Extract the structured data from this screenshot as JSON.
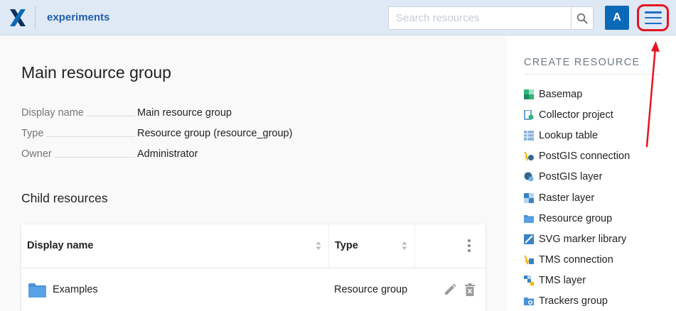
{
  "header": {
    "title": "experiments",
    "search_placeholder": "Search resources",
    "avatar_letter": "A",
    "logo_icon": "nextgis-x-logo",
    "brand_color": "#0b6ab8",
    "highlight_color": "#e5141f"
  },
  "main": {
    "title": "Main resource group",
    "properties": [
      {
        "label": "Display name",
        "value": "Main resource group"
      },
      {
        "label": "Type",
        "value": "Resource group (resource_group)"
      },
      {
        "label": "Owner",
        "value": "Administrator"
      }
    ],
    "child_section_title": "Child resources",
    "table": {
      "columns": [
        "Display name",
        "Type"
      ],
      "rows": [
        {
          "name": "Examples",
          "type": "Resource group",
          "icon": "folder-icon"
        }
      ]
    }
  },
  "sidebar": {
    "title": "CREATE RESOURCE",
    "items": [
      {
        "label": "Basemap",
        "icon": "basemap-icon"
      },
      {
        "label": "Collector project",
        "icon": "collector-icon"
      },
      {
        "label": "Lookup table",
        "icon": "lookup-table-icon"
      },
      {
        "label": "PostGIS connection",
        "icon": "postgis-connection-icon"
      },
      {
        "label": "PostGIS layer",
        "icon": "postgis-layer-icon"
      },
      {
        "label": "Raster layer",
        "icon": "raster-layer-icon"
      },
      {
        "label": "Resource group",
        "icon": "folder-icon"
      },
      {
        "label": "SVG marker library",
        "icon": "svg-marker-icon"
      },
      {
        "label": "TMS connection",
        "icon": "tms-connection-icon"
      },
      {
        "label": "TMS layer",
        "icon": "tms-layer-icon"
      },
      {
        "label": "Trackers group",
        "icon": "trackers-group-icon"
      }
    ]
  }
}
